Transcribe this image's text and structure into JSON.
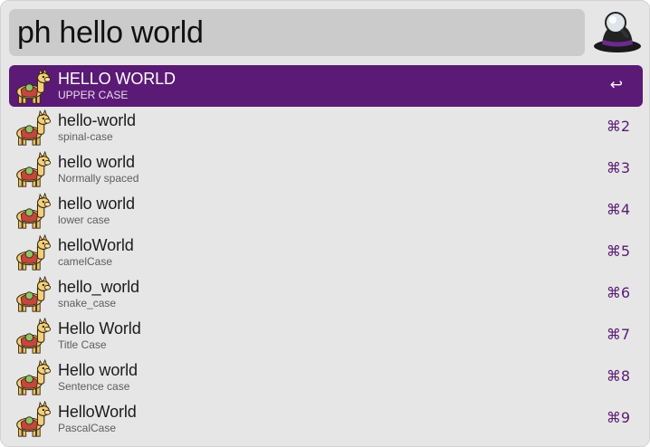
{
  "search": {
    "query": "ph hello world"
  },
  "app_icon": "alfred-hat-icon",
  "result_icon": "alpaca-icon",
  "colors": {
    "selection": "#5b1a76",
    "shortcut": "#5b1a76",
    "background": "#e6e6e6",
    "search_field": "#cbcbcb"
  },
  "results": [
    {
      "title": "HELLO WORLD",
      "subtitle": "UPPER CASE",
      "shortcut": "↩",
      "selected": true
    },
    {
      "title": "hello-world",
      "subtitle": "spinal-case",
      "shortcut": "⌘2"
    },
    {
      "title": "hello world",
      "subtitle": "Normally spaced",
      "shortcut": "⌘3"
    },
    {
      "title": "hello world",
      "subtitle": "lower case",
      "shortcut": "⌘4"
    },
    {
      "title": "helloWorld",
      "subtitle": "camelCase",
      "shortcut": "⌘5"
    },
    {
      "title": "hello_world",
      "subtitle": "snake_case",
      "shortcut": "⌘6"
    },
    {
      "title": "Hello World",
      "subtitle": "Title Case",
      "shortcut": "⌘7"
    },
    {
      "title": "Hello world",
      "subtitle": "Sentence case",
      "shortcut": "⌘8"
    },
    {
      "title": "HelloWorld",
      "subtitle": "PascalCase",
      "shortcut": "⌘9"
    }
  ]
}
